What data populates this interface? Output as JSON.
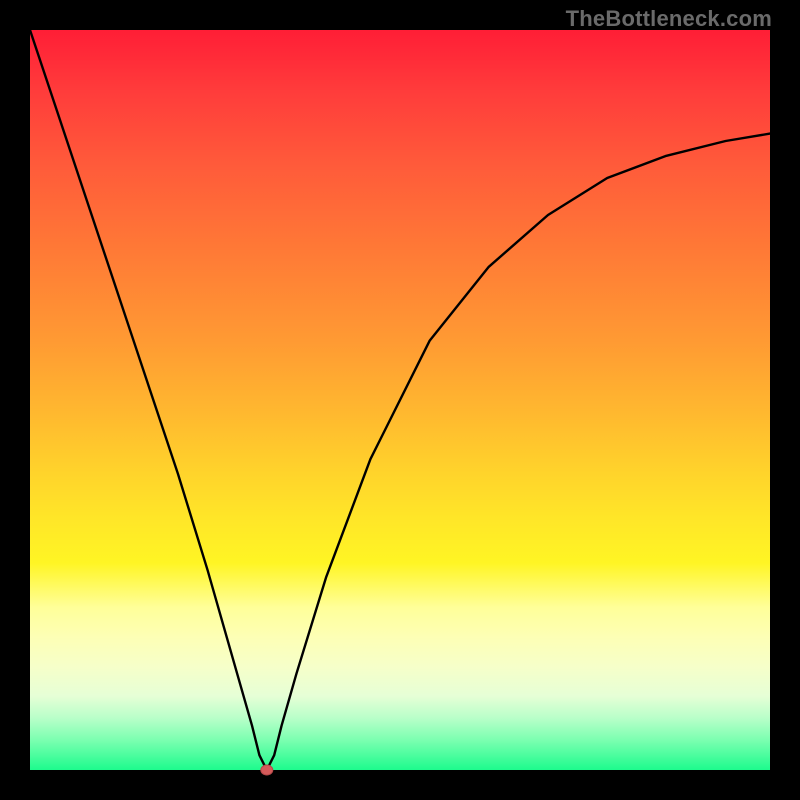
{
  "watermark": "TheBottleneck.com",
  "colors": {
    "frame": "#000000",
    "curve": "#000000",
    "dot_fill": "#d45a5a",
    "dot_stroke": "#b54848"
  },
  "chart_data": {
    "type": "line",
    "title": "",
    "xlabel": "",
    "ylabel": "",
    "xlim": [
      0,
      100
    ],
    "ylim": [
      0,
      100
    ],
    "grid": false,
    "dip_x": 32,
    "series": [
      {
        "name": "curve",
        "x": [
          0,
          4,
          8,
          12,
          16,
          20,
          24,
          28,
          30,
          31,
          32,
          33,
          34,
          36,
          40,
          46,
          54,
          62,
          70,
          78,
          86,
          94,
          100
        ],
        "y": [
          100,
          88,
          76,
          64,
          52,
          40,
          27,
          13,
          6,
          2,
          0,
          2,
          6,
          13,
          26,
          42,
          58,
          68,
          75,
          80,
          83,
          85,
          86
        ]
      }
    ],
    "marker": {
      "x": 32,
      "y": 0,
      "rx": 6,
      "ry": 5
    }
  }
}
